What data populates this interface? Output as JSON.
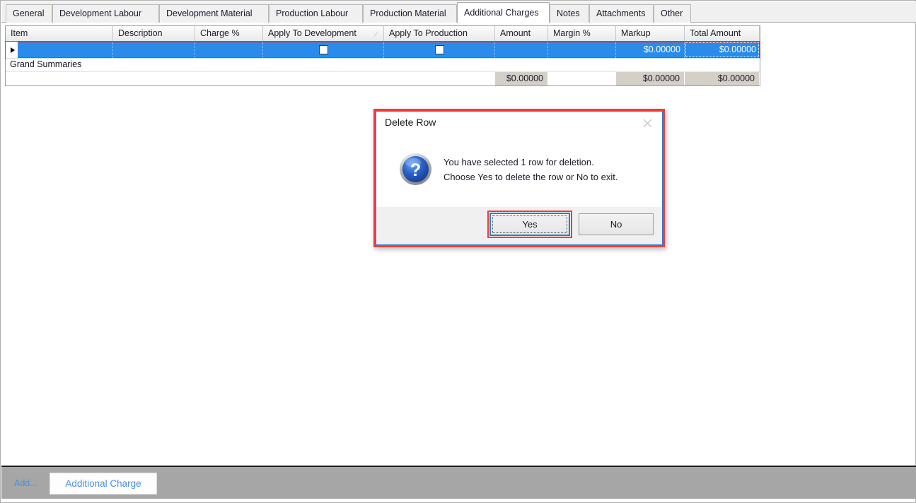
{
  "tabs": [
    {
      "label": "General",
      "selected": false
    },
    {
      "label": "Development Labour",
      "selected": false
    },
    {
      "label": "Development Material",
      "selected": false
    },
    {
      "label": "Production Labour",
      "selected": false
    },
    {
      "label": "Production Material",
      "selected": false
    },
    {
      "label": "Additional Charges",
      "selected": true
    },
    {
      "label": "Notes",
      "selected": false
    },
    {
      "label": "Attachments",
      "selected": false
    },
    {
      "label": "Other",
      "selected": false
    }
  ],
  "grid": {
    "columns": [
      {
        "label": "Item"
      },
      {
        "label": "Description"
      },
      {
        "label": "Charge %"
      },
      {
        "label": "Apply To Development",
        "sort_indicator": "⁄"
      },
      {
        "label": "Apply To Production"
      },
      {
        "label": "Amount"
      },
      {
        "label": "Margin %"
      },
      {
        "label": "Markup"
      },
      {
        "label": "Total Amount"
      }
    ],
    "row": {
      "item": "",
      "description": "",
      "charge_pct": "",
      "apply_to_development": false,
      "apply_to_production": false,
      "amount": "",
      "margin_pct": "",
      "markup": "$0.00000",
      "total_amount": "$0.00000"
    },
    "grand_summaries_label": "Grand Summaries",
    "summary": {
      "item": "",
      "description": "",
      "charge_pct": "",
      "apply_to_development": "",
      "apply_to_production": "",
      "amount": "$0.00000",
      "margin_pct": "",
      "markup": "$0.00000",
      "total_amount": "$0.00000"
    }
  },
  "dialog": {
    "title": "Delete Row",
    "message_line1": "You have selected 1 row for deletion.",
    "message_line2": "Choose Yes to delete the row or No to exit.",
    "yes_label": "Yes",
    "no_label": "No",
    "icon": "question-icon",
    "close_icon": "close-icon"
  },
  "bottom_bar": {
    "add_label": "Add...",
    "additional_charge_label": "Additional Charge"
  },
  "colors": {
    "selection_blue": "#2a8beb",
    "highlight_red": "#f03c3c",
    "focus_blue": "#2a7fd4",
    "link_blue": "#4a90e2",
    "toolbar_gray": "#a6a6a6",
    "summary_gray": "#d4d0c8"
  }
}
